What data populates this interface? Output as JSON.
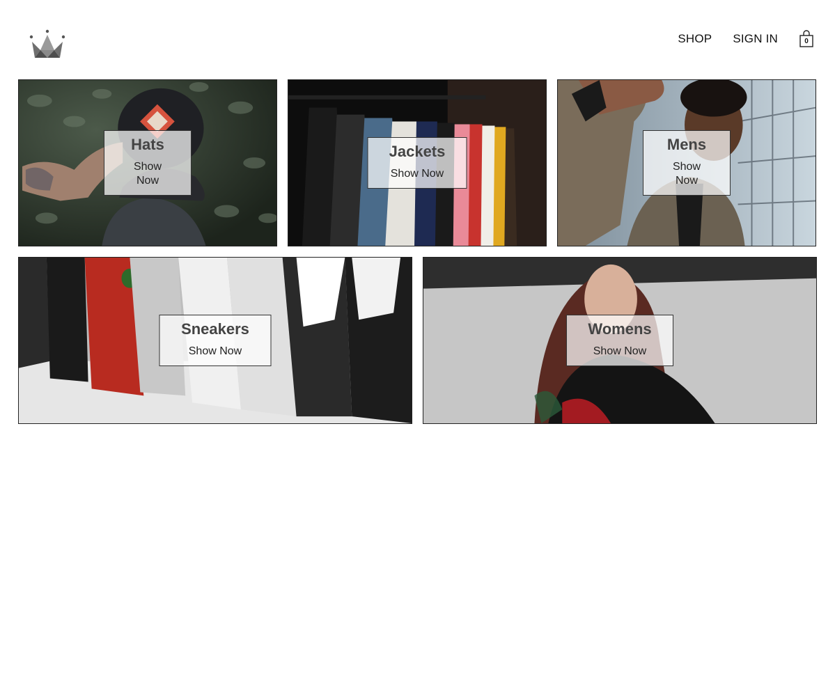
{
  "header": {
    "logo_icon": "crown-icon",
    "nav": {
      "shop_label": "SHOP",
      "sign_in_label": "SIGN IN"
    },
    "cart": {
      "icon": "shopping-bag-icon",
      "count": "0"
    }
  },
  "directory": {
    "items": [
      {
        "title": "Hats",
        "cta": "Show Now"
      },
      {
        "title": "Jackets",
        "cta": "Show Now"
      },
      {
        "title": "Mens",
        "cta": "Show Now"
      },
      {
        "title": "Sneakers",
        "cta": "Show Now"
      },
      {
        "title": "Womens",
        "cta": "Show Now"
      }
    ]
  }
}
